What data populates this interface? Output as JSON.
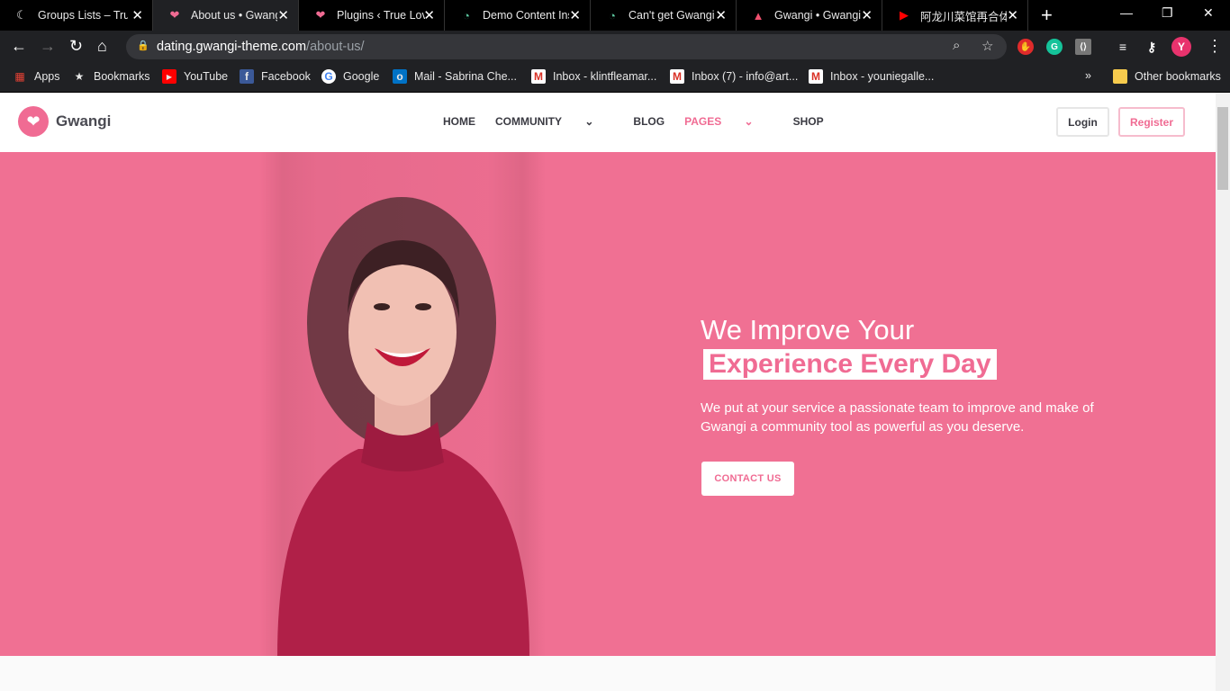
{
  "browser": {
    "tabs": [
      {
        "title": "Groups Lists – True",
        "icon": "moon-icon"
      },
      {
        "title": "About us • Gwangi",
        "icon": "heart-icon",
        "active": true
      },
      {
        "title": "Plugins ‹ True Love",
        "icon": "heart-icon"
      },
      {
        "title": "Demo Content Ins",
        "icon": "swirl-icon"
      },
      {
        "title": "Can't get Gwangi",
        "icon": "swirl-icon"
      },
      {
        "title": "Gwangi • Gwangi",
        "icon": "chevron-logo-icon"
      },
      {
        "title": "阿龙川菜馆再合体",
        "icon": "youtube-icon"
      }
    ],
    "url_host": "dating.gwangi-theme.com",
    "url_path": "/about-us/",
    "profile_initial": "Y",
    "bookmarks": [
      {
        "label": "Apps"
      },
      {
        "label": "Bookmarks"
      },
      {
        "label": "YouTube"
      },
      {
        "label": "Facebook"
      },
      {
        "label": "Google"
      },
      {
        "label": "Mail - Sabrina Che..."
      },
      {
        "label": "Inbox - klintfleamar..."
      },
      {
        "label": "Inbox (7) - info@art..."
      },
      {
        "label": "Inbox - youniegalle..."
      }
    ],
    "overflow": "»",
    "other_bookmarks": "Other bookmarks"
  },
  "site": {
    "logo": "Gwangi",
    "menu": [
      {
        "label": "HOME"
      },
      {
        "label": "COMMUNITY"
      },
      {
        "label": "BLOG"
      },
      {
        "label": "PAGES"
      },
      {
        "label": "SHOP"
      }
    ],
    "login": "Login",
    "register": "Register",
    "hero": {
      "line1": "We Improve Your",
      "line2": "Experience Every Day",
      "body": "We put at your service a passionate team to improve and make of Gwangi a community tool as powerful as you deserve.",
      "cta": "CONTACT US"
    }
  },
  "colors": {
    "brand": "#f06b93",
    "hero_bg": "#f07093",
    "chrome_bg": "#000000"
  }
}
